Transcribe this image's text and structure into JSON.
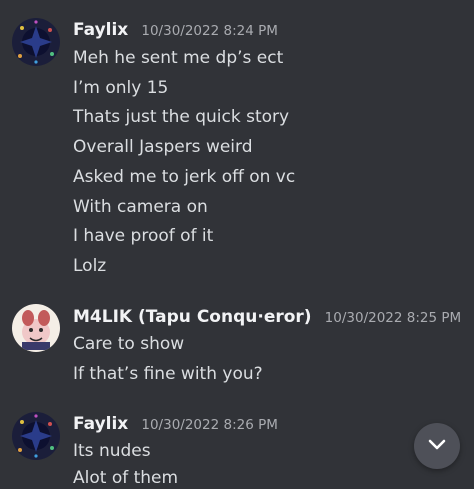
{
  "messages": [
    {
      "username": "Faylix",
      "timestamp": "10/30/2022 8:24 PM",
      "lines": [
        "Meh he sent me dp’s ect",
        "I’m only 15",
        "Thats just the quick story",
        "Overall Jaspers weird",
        "Asked me to jerk off on vc",
        "With camera on",
        "I have proof of it",
        "Lolz"
      ]
    },
    {
      "username": "M4LIK (Tapu Conqu·eror)",
      "timestamp": "10/30/2022 8:25 PM",
      "lines": [
        "Care to show",
        "If that’s fine with you?"
      ]
    },
    {
      "username": "Faylix",
      "timestamp": "10/30/2022 8:26 PM",
      "lines": [
        "Its nudes",
        "Alot of them"
      ]
    }
  ],
  "colors": {
    "background": "#313338",
    "username": "#f2f3f5",
    "message_text": "#dbdee1",
    "timestamp": "#a9abb0",
    "scroll_button": "#4e5058"
  },
  "icons": {
    "scroll_button": "chevron-down-icon"
  }
}
